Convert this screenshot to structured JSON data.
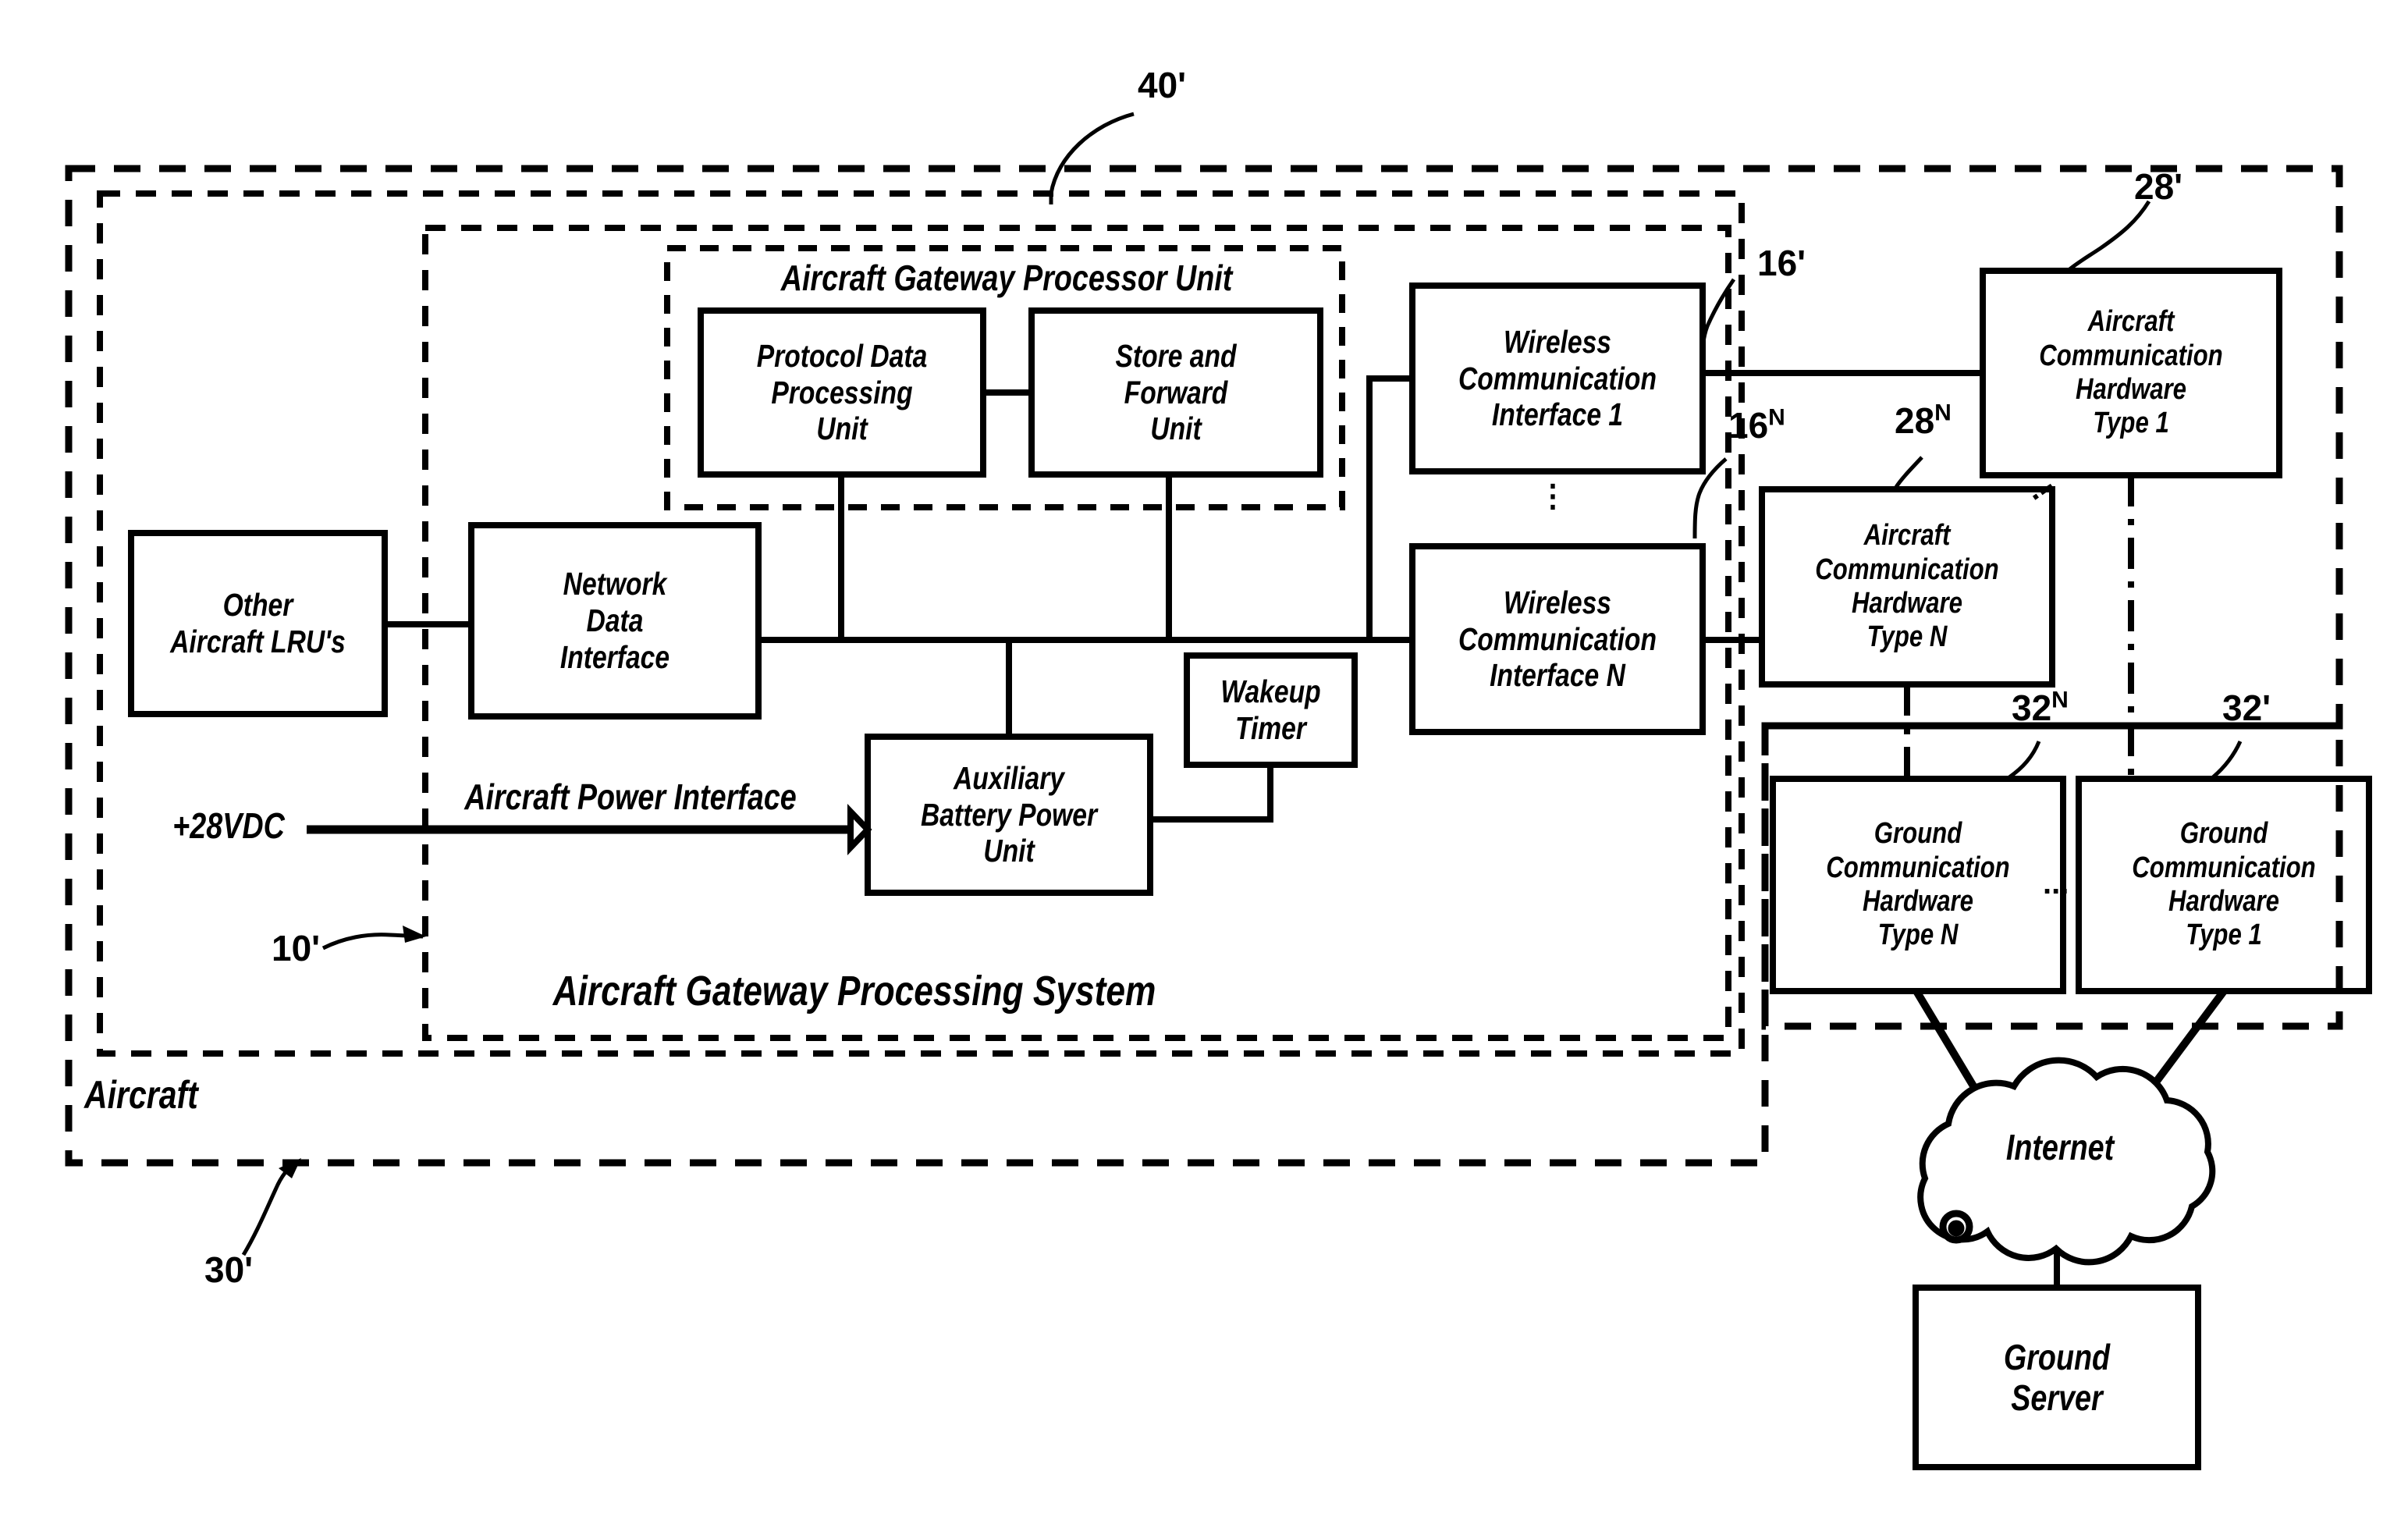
{
  "figure": {
    "title": "Aircraft Gateway Processing System block diagram",
    "style": "patent-line-drawing"
  },
  "boundaries": {
    "aircraft": {
      "label": "Aircraft",
      "ref": "30'",
      "line": "dashed"
    },
    "system_40": {
      "ref": "40'",
      "line": "dashed"
    },
    "processing_system": {
      "label": "Aircraft Gateway Processing System",
      "ref": "10'",
      "line": "dashed"
    },
    "processor_unit": {
      "label": "Aircraft Gateway Processor Unit",
      "line": "dashed"
    },
    "ground": {
      "line": "dashed"
    }
  },
  "blocks": {
    "other_lru": "Other\nAircraft LRU's",
    "network_data_interface": "Network\nData\nInterface",
    "protocol_data_processing_unit": "Protocol Data\nProcessing\nUnit",
    "store_and_forward_unit": "Store and\nForward\nUnit",
    "auxiliary_battery_power_unit": "Auxiliary\nBattery Power\nUnit",
    "wakeup_timer": "Wakeup\nTimer",
    "wireless_interface_1": "Wireless\nCommunication\nInterface 1",
    "wireless_interface_n": "Wireless\nCommunication\nInterface N",
    "aircraft_comm_hw_1": "Aircraft\nCommunication\nHardware\nType 1",
    "aircraft_comm_hw_n": "Aircraft\nCommunication\nHardware\nType N",
    "ground_comm_hw_n": "Ground\nCommunication\nHardware\nType N",
    "ground_comm_hw_1": "Ground\nCommunication\nHardware\nType 1",
    "internet": "Internet",
    "ground_server": "Ground\nServer"
  },
  "signals": {
    "power_input": "+28VDC",
    "power_interface": "Aircraft Power Interface"
  },
  "references": {
    "r40": "40'",
    "r28p": "28'",
    "r16p": "16'",
    "r16n_base": "16",
    "r16n_sup": "N",
    "r28n_base": "28",
    "r28n_sup": "N",
    "r32n_base": "32",
    "r32n_sup": "N",
    "r32p": "32'",
    "r10p": "10'",
    "r30p": "30'"
  },
  "ellipses": {
    "wireless_vertical": "⋮",
    "aircraft_hw_vertical": "⋰",
    "ground_hw_horizontal": "...",
    "aircraft_hw_dots": "⋰"
  }
}
